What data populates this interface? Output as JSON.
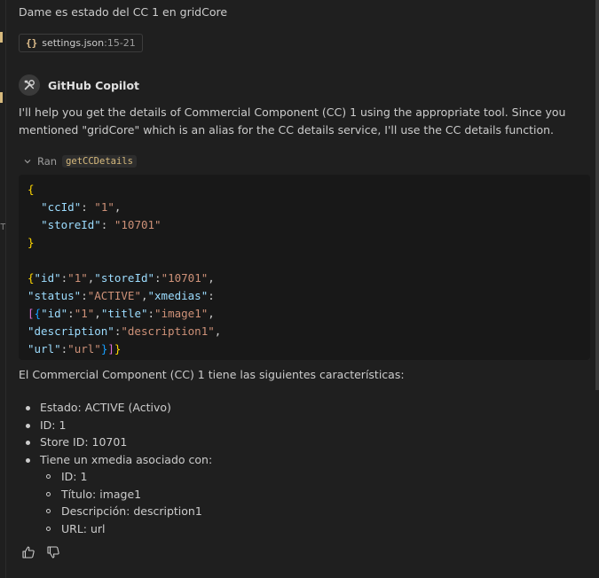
{
  "user_message": "Dame es estado del CC 1 en gridCore",
  "attachment": {
    "name": "settings.json",
    "range": ":15-21",
    "icon": "braces-icon"
  },
  "agent": {
    "name": "GitHub Copilot",
    "icon": "copilot-tools-icon"
  },
  "intro": "I'll help you get the details of Commercial Component (CC) 1 using the appropriate tool. Since you mentioned \"gridCore\" which is an alias for the CC details service, I'll use the CC details function.",
  "tool_run": {
    "label": "Ran",
    "tool": "getCCDetails"
  },
  "code": {
    "input": {
      "ccId": "1",
      "storeId": "10701"
    },
    "output": {
      "id": "1",
      "storeId": "10701",
      "status": "ACTIVE",
      "xmedias_key": "xmedias",
      "xmedia": {
        "id": "1",
        "title": "image1",
        "description": "description1",
        "url": "url"
      }
    }
  },
  "summary": "El Commercial Component (CC) 1 tiene las siguientes características:",
  "facts": [
    "Estado: ACTIVE (Activo)",
    "ID: 1",
    "Store ID: 10701",
    "Tiene un xmedia asociado con:"
  ],
  "subfacts": [
    "ID: 1",
    "Título: image1",
    "Descripción: description1",
    "URL: url"
  ],
  "colors": {
    "background": "#1f1f1f",
    "code_bg": "#181818",
    "string": "#ce9178",
    "key": "#9cdcfe",
    "brace": "#ffd700"
  }
}
